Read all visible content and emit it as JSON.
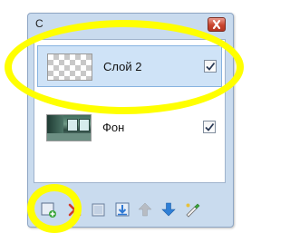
{
  "window": {
    "title": "С",
    "close_icon": "close-icon"
  },
  "layers": [
    {
      "name": "Слой 2",
      "thumbnail": "transparent-checker",
      "visible": true,
      "selected": true
    },
    {
      "name": "Фон",
      "thumbnail": "photo",
      "visible": true,
      "selected": false
    }
  ],
  "toolbar": {
    "tools": [
      {
        "icon": "new-layer-icon"
      },
      {
        "icon": "delete-layer-icon"
      },
      {
        "icon": "duplicate-layer-icon"
      },
      {
        "icon": "merge-down-icon"
      },
      {
        "icon": "move-up-icon"
      },
      {
        "icon": "move-down-icon"
      },
      {
        "icon": "layer-properties-icon"
      }
    ]
  },
  "annotations": {
    "highlight_color": "#ffff00"
  },
  "colors": {
    "window_bg": "#c9dbee",
    "selection_bg": "#cfe3f7",
    "close_button": "#c9452f"
  }
}
